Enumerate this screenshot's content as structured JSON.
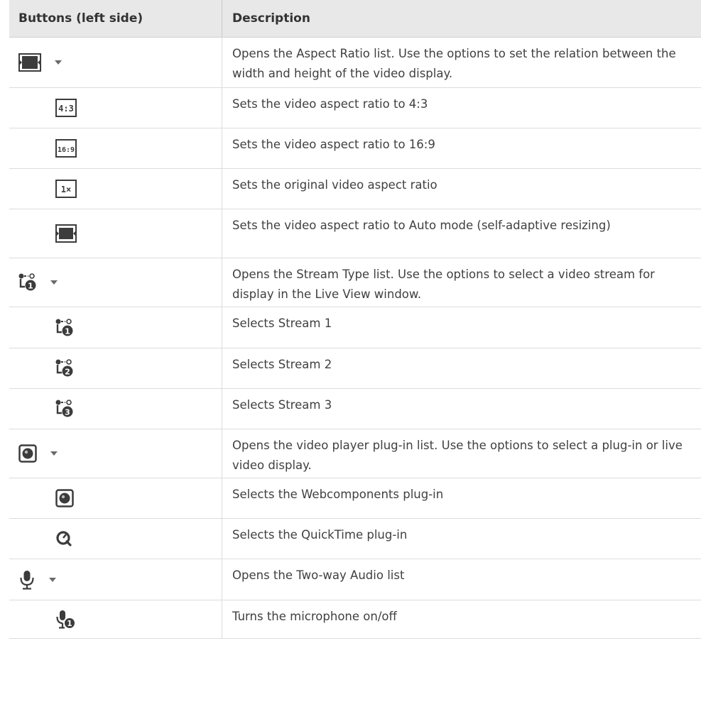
{
  "header": {
    "col1": "Buttons (left side)",
    "col2": "Description"
  },
  "rows": [
    {
      "icon": "aspect-ratio-icon",
      "level": "main",
      "dropdown": true,
      "description": "Opens the Aspect Ratio list. Use the options to set the relation between the width and height of the video display."
    },
    {
      "icon": "ratio-4-3-icon",
      "level": "sub",
      "dropdown": false,
      "description": "Sets the video aspect ratio to 4:3",
      "icon_text": "4:3"
    },
    {
      "icon": "ratio-16-9-icon",
      "level": "sub",
      "dropdown": false,
      "description": "Sets the video aspect ratio to 16:9",
      "icon_text": "16:9"
    },
    {
      "icon": "ratio-original-icon",
      "level": "sub",
      "dropdown": false,
      "description": "Sets the original video aspect ratio",
      "icon_text": "1×"
    },
    {
      "icon": "ratio-auto-icon",
      "level": "sub",
      "dropdown": false,
      "description": "Sets the video aspect ratio to Auto mode (self-adaptive resizing)"
    },
    {
      "icon": "stream-type-icon",
      "level": "main",
      "dropdown": true,
      "description": "Opens the Stream Type list. Use the options to select a video stream for display in the Live View window."
    },
    {
      "icon": "stream-1-icon",
      "level": "sub",
      "dropdown": false,
      "description": "Selects Stream 1",
      "icon_text": "1"
    },
    {
      "icon": "stream-2-icon",
      "level": "sub",
      "dropdown": false,
      "description": "Selects Stream 2",
      "icon_text": "2"
    },
    {
      "icon": "stream-3-icon",
      "level": "sub",
      "dropdown": false,
      "description": "Selects Stream 3",
      "icon_text": "3"
    },
    {
      "icon": "video-plugin-icon",
      "level": "main",
      "dropdown": true,
      "description": "Opens the video player plug-in list. Use the options to select a plug-in or live video display."
    },
    {
      "icon": "webcomponents-plugin-icon",
      "level": "sub",
      "dropdown": false,
      "description": "Selects the Webcomponents plug-in"
    },
    {
      "icon": "quicktime-plugin-icon",
      "level": "sub",
      "dropdown": false,
      "description": "Selects the QuickTime plug-in"
    },
    {
      "icon": "microphone-icon",
      "level": "main",
      "dropdown": true,
      "description": "Opens the Two-way Audio list"
    },
    {
      "icon": "microphone-toggle-icon",
      "level": "sub",
      "dropdown": false,
      "description": "Turns the microphone on/off",
      "icon_text": "1"
    }
  ],
  "colors": {
    "header_bg": "#e8e8e8",
    "border": "#dcdcdc",
    "icon_dark": "#3c3c3c",
    "caret": "#6a6a6a"
  }
}
